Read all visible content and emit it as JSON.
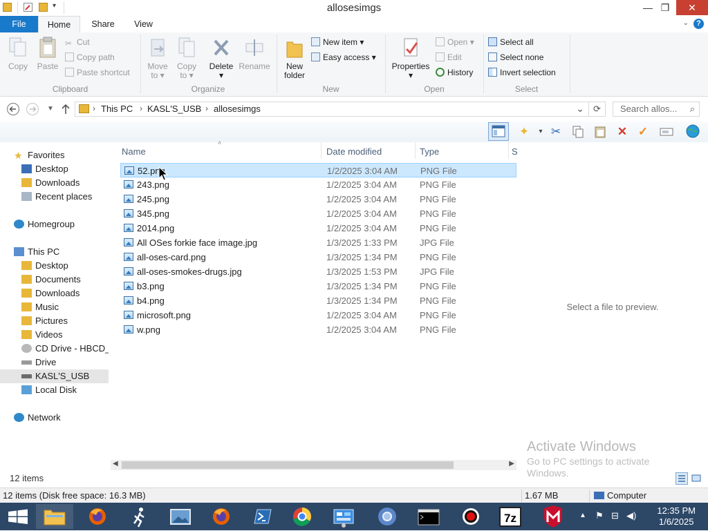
{
  "window": {
    "title": "allosesimgs",
    "controls": {
      "minimize": "—",
      "maximize": "❐",
      "close": "✕"
    }
  },
  "ribbon_tabs": [
    "File",
    "Home",
    "Share",
    "View"
  ],
  "ribbon": {
    "clipboard": {
      "copy": "Copy",
      "paste": "Paste",
      "cut": "Cut",
      "copy_path": "Copy path",
      "paste_shortcut": "Paste shortcut",
      "label": "Clipboard"
    },
    "organize": {
      "move_to": [
        "Move",
        "to ▾"
      ],
      "copy_to": [
        "Copy",
        "to ▾"
      ],
      "delete": "Delete",
      "delete_arrow": "▾",
      "rename": "Rename",
      "label": "Organize"
    },
    "new": {
      "new_folder": [
        "New",
        "folder"
      ],
      "new_item": "New item ▾",
      "easy_access": "Easy access ▾",
      "label": "New"
    },
    "open": {
      "properties": "Properties",
      "properties_arrow": "▾",
      "open": "Open ▾",
      "edit": "Edit",
      "history": "History",
      "label": "Open"
    },
    "select": {
      "select_all": "Select all",
      "select_none": "Select none",
      "invert_selection": "Invert selection",
      "label": "Select"
    }
  },
  "address": {
    "crumbs": [
      "This PC",
      "KASL'S_USB",
      "allosesimgs"
    ],
    "search_placeholder": "Search allos...",
    "dropdown": "⌄",
    "refresh": "⟳"
  },
  "nav": {
    "favorites": {
      "label": "Favorites",
      "items": [
        "Desktop",
        "Downloads",
        "Recent places"
      ]
    },
    "homegroup": "Homegroup",
    "thispc": {
      "label": "This PC",
      "items": [
        "Desktop",
        "Documents",
        "Downloads",
        "Music",
        "Pictures",
        "Videos",
        "CD Drive - HBCD_",
        "Drive",
        "KASL'S_USB",
        "Local Disk"
      ]
    },
    "network": "Network"
  },
  "columns": {
    "name": "Name",
    "date": "Date modified",
    "type": "Type",
    "size": "S"
  },
  "files": [
    {
      "name": "52.png",
      "date": "1/2/2025 3:04 AM",
      "type": "PNG File"
    },
    {
      "name": "243.png",
      "date": "1/2/2025 3:04 AM",
      "type": "PNG File"
    },
    {
      "name": "245.png",
      "date": "1/2/2025 3:04 AM",
      "type": "PNG File"
    },
    {
      "name": "345.png",
      "date": "1/2/2025 3:04 AM",
      "type": "PNG File"
    },
    {
      "name": "2014.png",
      "date": "1/2/2025 3:04 AM",
      "type": "PNG File"
    },
    {
      "name": "All OSes forkie face image.jpg",
      "date": "1/3/2025 1:33 PM",
      "type": "JPG File"
    },
    {
      "name": "all-oses-card.png",
      "date": "1/3/2025 1:34 PM",
      "type": "PNG File"
    },
    {
      "name": "all-oses-smokes-drugs.jpg",
      "date": "1/3/2025 1:53 PM",
      "type": "JPG File"
    },
    {
      "name": "b3.png",
      "date": "1/3/2025 1:34 PM",
      "type": "PNG File"
    },
    {
      "name": "b4.png",
      "date": "1/3/2025 1:34 PM",
      "type": "PNG File"
    },
    {
      "name": "microsoft.png",
      "date": "1/2/2025 3:04 AM",
      "type": "PNG File"
    },
    {
      "name": "w.png",
      "date": "1/2/2025 3:04 AM",
      "type": "PNG File"
    }
  ],
  "preview": {
    "text": "Select a file to preview."
  },
  "watermark": {
    "title": "Activate Windows",
    "subtitle": "Go to PC settings to activate Windows."
  },
  "items_count": "12 items",
  "status": {
    "left": "12 items (Disk free space: 16.3 MB)",
    "size": "1.67 MB",
    "location": "Computer"
  },
  "taskbar": {
    "apps": [
      "start",
      "file-explorer",
      "firefox",
      "runner",
      "photos",
      "firefox-2",
      "powershell",
      "chrome",
      "control-panel",
      "chromium",
      "cmd",
      "record",
      "7zip",
      "mcafee"
    ],
    "time": "12:35 PM",
    "date": "1/6/2025"
  },
  "colors": {
    "accent": "#1979ca",
    "selection": "#cce8ff",
    "taskbar": "#2d4767"
  }
}
